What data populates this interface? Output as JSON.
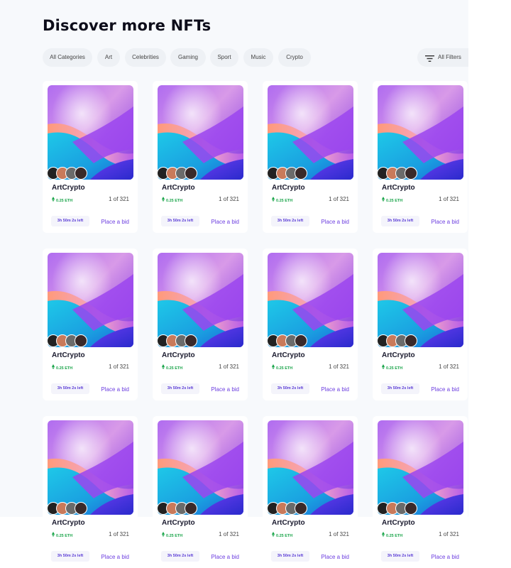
{
  "page": {
    "title": "Discover more NFTs"
  },
  "categories": [
    {
      "label": "All Categories"
    },
    {
      "label": "Art"
    },
    {
      "label": "Celebrities"
    },
    {
      "label": "Gaming"
    },
    {
      "label": "Sport"
    },
    {
      "label": "Music"
    },
    {
      "label": "Crypto"
    }
  ],
  "filters": {
    "label": "All Filters",
    "icon": "filter-icon"
  },
  "card": {
    "name": "ArtCrypto",
    "price": "0.25 ETH",
    "edition": "1 of 321",
    "timer": "3h 50m 2s left",
    "bid_label": "Place a bid",
    "price_icon": "ethereum-icon"
  },
  "grid": {
    "rows": 3,
    "cols": 4
  },
  "colors": {
    "accent": "#6d3fe0",
    "price": "#1aa54a",
    "background": "#f7f9fc"
  }
}
